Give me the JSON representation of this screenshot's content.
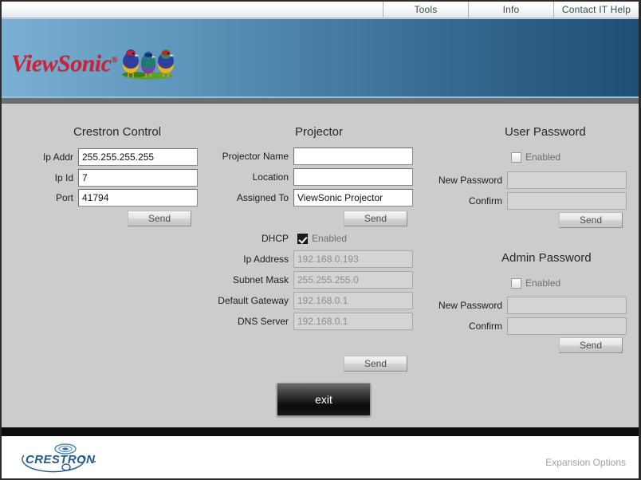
{
  "nav": {
    "tabs": [
      {
        "label": "Tools",
        "name": "tab-tools"
      },
      {
        "label": "Info",
        "name": "tab-info"
      },
      {
        "label": "Contact IT Help",
        "name": "tab-contact-it-help"
      }
    ]
  },
  "banner": {
    "brand": "ViewSonic",
    "registered_mark": "®",
    "logo_icon": "viewsonic-finches-logo",
    "gradient_from": "#7bb0d2",
    "gradient_to": "#1f4e75"
  },
  "crestron_control": {
    "title": "Crestron Control",
    "fields": [
      {
        "label": "Ip Addr",
        "value": "255.255.255.255",
        "disabled": false
      },
      {
        "label": "Ip Id",
        "value": "7",
        "disabled": false
      },
      {
        "label": "Port",
        "value": "41794",
        "disabled": false
      }
    ],
    "send_label": "Send"
  },
  "projector": {
    "title": "Projector",
    "fields": [
      {
        "label": "Projector Name",
        "value": "",
        "disabled": false
      },
      {
        "label": "Location",
        "value": "",
        "disabled": false
      },
      {
        "label": "Assigned To",
        "value": "ViewSonic Projector",
        "disabled": false
      }
    ],
    "send_label": "Send",
    "dhcp": {
      "label": "DHCP",
      "checkbox_text": "Enabled",
      "checked": true
    },
    "network_fields": [
      {
        "label": "Ip Address",
        "value": "192.168.0.193",
        "disabled": true
      },
      {
        "label": "Subnet Mask",
        "value": "255.255.255.0",
        "disabled": true
      },
      {
        "label": "Default Gateway",
        "value": "192.168.0.1",
        "disabled": true
      },
      {
        "label": "DNS Server",
        "value": "192.168.0.1",
        "disabled": true
      }
    ],
    "network_send_label": "Send"
  },
  "user_password": {
    "title": "User Password",
    "enabled_label": "Enabled",
    "enabled_checked": false,
    "fields": [
      {
        "label": "New Password",
        "value": "",
        "disabled": true
      },
      {
        "label": "Confirm",
        "value": "",
        "disabled": true
      }
    ],
    "send_label": "Send"
  },
  "admin_password": {
    "title": "Admin Password",
    "enabled_label": "Enabled",
    "enabled_checked": false,
    "fields": [
      {
        "label": "New Password",
        "value": "",
        "disabled": true
      },
      {
        "label": "Confirm",
        "value": "",
        "disabled": true
      }
    ],
    "send_label": "Send"
  },
  "exit_button": {
    "label": "exit"
  },
  "footer": {
    "logo_text": "CRESTRON",
    "logo_icon": "crestron-swoosh-logo",
    "expansion_options": "Expansion Options"
  }
}
